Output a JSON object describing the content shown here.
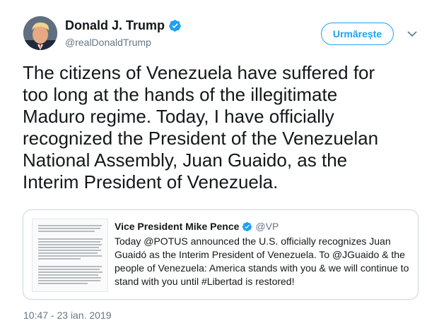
{
  "author": {
    "display_name": "Donald J. Trump",
    "handle": "@realDonaldTrump",
    "verified": true
  },
  "follow_button": {
    "label": "Urmărește"
  },
  "tweet": {
    "lines": [
      "The citizens of Venezuela have suffered for",
      "too long at the hands of the illegitimate",
      "Maduro regime. Today, I have officially",
      "recognized the President of the Venezuelan",
      "National Assembly, Juan Guaido, as the",
      "Interim President of Venezuela."
    ]
  },
  "quoted_tweet": {
    "display_name": "Vice President Mike Pence",
    "handle": "@VP",
    "verified": true,
    "lines": [
      "Today @POTUS announced the U.S. officially recognizes Juan",
      "Guaidó as the Interim President of Venezuela. To @JGuaido & the",
      "people of Venezuela: America stands with you & we will continue to",
      "stand with you until #Libertad is restored!"
    ]
  },
  "timestamp": "10:47 - 23 ian. 2019",
  "colors": {
    "accent": "#1da1f2",
    "text": "#14171a",
    "secondary_text": "#657786",
    "border": "#ccd6dd"
  },
  "icons": {
    "verified": "verified-badge-icon",
    "caret": "chevron-down-icon"
  }
}
